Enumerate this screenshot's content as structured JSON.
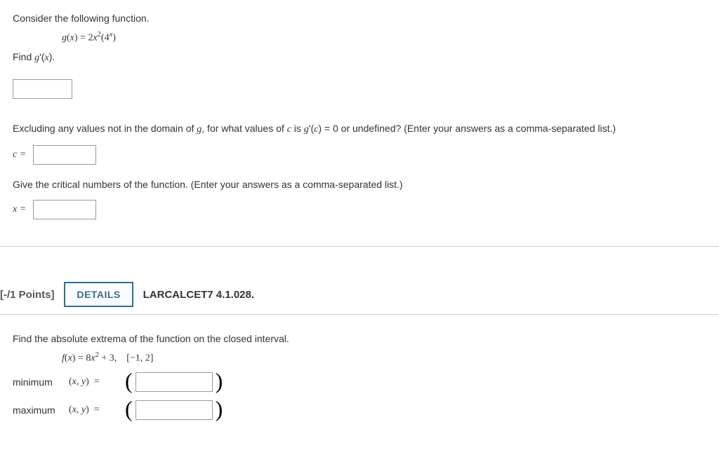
{
  "q1": {
    "intro": "Consider the following function.",
    "formula_html": "g(x) = 2x²(4ˣ)",
    "find_label": "Find g'(x).",
    "excluding_text": "Excluding any values not in the domain of g, for what values of c is g'(c) = 0 or undefined? (Enter your answers as a comma-separated list.)",
    "c_label": "c =",
    "critical_text": "Give the critical numbers of the function. (Enter your answers as a comma-separated list.)",
    "x_label": "x ="
  },
  "q2": {
    "points_label": "[-/1 Points]",
    "details_btn": "DETAILS",
    "reference": "LARCALCET7 4.1.028.",
    "prompt": "Find the absolute extrema of the function on the closed interval.",
    "formula_html": "f(x) = 8x² + 3,    [−1, 2]",
    "minimum_label": "minimum",
    "maximum_label": "maximum",
    "xy_label": "(x, y)  ="
  }
}
